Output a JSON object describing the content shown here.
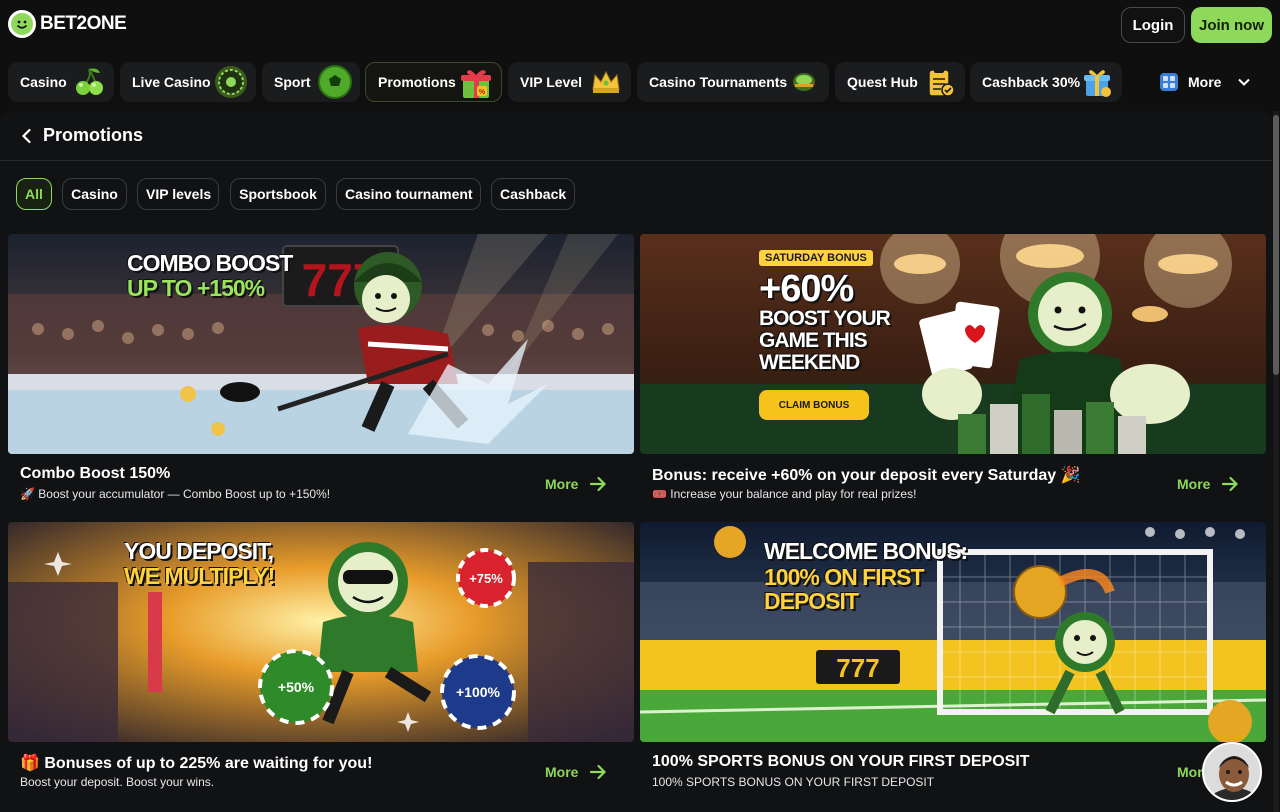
{
  "header": {
    "logo_text": "BET2ONE",
    "login_label": "Login",
    "join_label": "Join now"
  },
  "nav": {
    "items": [
      {
        "label": "Casino",
        "icon": "cherry-icon"
      },
      {
        "label": "Live Casino",
        "icon": "roulette-icon"
      },
      {
        "label": "Sport",
        "icon": "soccer-ball-icon"
      },
      {
        "label": "Promotions",
        "icon": "gift-icon",
        "active": true
      },
      {
        "label": "VIP Level",
        "icon": "crown-icon"
      },
      {
        "label": "Casino Tournaments",
        "icon": "trophy-icon"
      },
      {
        "label": "Quest Hub",
        "icon": "clipboard-icon"
      },
      {
        "label": "Cashback 30%",
        "icon": "gift-box-icon"
      }
    ],
    "more_label": "More"
  },
  "page": {
    "title": "Promotions"
  },
  "filters": [
    {
      "label": "All",
      "active": true
    },
    {
      "label": "Casino"
    },
    {
      "label": "VIP levels"
    },
    {
      "label": "Sportsbook"
    },
    {
      "label": "Casino tournament"
    },
    {
      "label": "Cashback"
    }
  ],
  "promos": [
    {
      "banner_line1": "COMBO BOOST",
      "banner_line2": "UP TO +150%",
      "title": "Combo Boost 150%",
      "subtitle": "🚀 Boost your accumulator — Combo Boost up to +150%!",
      "more_label": "More"
    },
    {
      "banner_tag": "SATURDAY BONUS",
      "banner_line1": "+60%",
      "banner_line2": "BOOST YOUR GAME THIS WEEKEND",
      "banner_button": "CLAIM BONUS",
      "title": "Bonus: receive +60% on your deposit every Saturday 🎉",
      "subtitle": "🎟️ Increase your balance and play for real prizes!",
      "more_label": "More"
    },
    {
      "banner_line1": "YOU DEPOSIT,",
      "banner_line2": "WE MULTIPLY!",
      "chip1": "+75%",
      "chip2": "+50%",
      "chip3": "+100%",
      "title": "🎁 Bonuses of up to 225% are waiting for you!",
      "subtitle": "Boost your deposit. Boost your wins.",
      "more_label": "More"
    },
    {
      "banner_line1": "WELCOME BONUS:",
      "banner_line2": "100% ON FIRST DEPOSIT",
      "title": "100% SPORTS BONUS ON YOUR FIRST DEPOSIT",
      "subtitle": "100% SPORTS BONUS ON YOUR FIRST DEPOSIT",
      "more_label": "More"
    }
  ],
  "colors": {
    "accent": "#8ed85a",
    "background": "#0f0f10",
    "panel": "#111214",
    "nav_item": "#1b1c1e"
  }
}
